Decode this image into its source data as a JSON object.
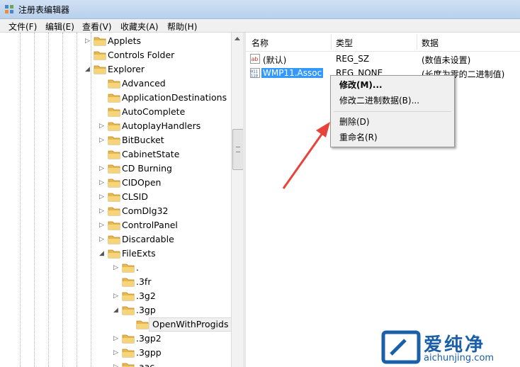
{
  "window": {
    "title": "注册表编辑器"
  },
  "menu": [
    "文件(F)",
    "编辑(E)",
    "查看(V)",
    "收藏夹(A)",
    "帮助(H)"
  ],
  "tree": [
    {
      "label": "Applets",
      "expander": "▷",
      "indent": 1
    },
    {
      "label": "Controls Folder",
      "expander": "",
      "indent": 1
    },
    {
      "label": "Explorer",
      "expander": "◢",
      "indent": 1
    },
    {
      "label": "Advanced",
      "expander": "",
      "indent": 2
    },
    {
      "label": "ApplicationDestinations",
      "expander": "",
      "indent": 2
    },
    {
      "label": "AutoComplete",
      "expander": "",
      "indent": 2
    },
    {
      "label": "AutoplayHandlers",
      "expander": "▷",
      "indent": 2
    },
    {
      "label": "BitBucket",
      "expander": "▷",
      "indent": 2
    },
    {
      "label": "CabinetState",
      "expander": "",
      "indent": 2
    },
    {
      "label": "CD Burning",
      "expander": "▷",
      "indent": 2
    },
    {
      "label": "CIDOpen",
      "expander": "▷",
      "indent": 2
    },
    {
      "label": "CLSID",
      "expander": "▷",
      "indent": 2
    },
    {
      "label": "ComDlg32",
      "expander": "▷",
      "indent": 2
    },
    {
      "label": "ControlPanel",
      "expander": "▷",
      "indent": 2
    },
    {
      "label": "Discardable",
      "expander": "▷",
      "indent": 2
    },
    {
      "label": "FileExts",
      "expander": "◢",
      "indent": 2
    },
    {
      "label": ".",
      "expander": "▷",
      "indent": 3
    },
    {
      "label": ".3fr",
      "expander": "",
      "indent": 3
    },
    {
      "label": ".3g2",
      "expander": "▷",
      "indent": 3
    },
    {
      "label": ".3gp",
      "expander": "◢",
      "indent": 3
    },
    {
      "label": "OpenWithProgids",
      "expander": "",
      "indent": 4,
      "selected": true
    },
    {
      "label": ".3gp2",
      "expander": "▷",
      "indent": 3
    },
    {
      "label": ".3gpp",
      "expander": "▷",
      "indent": 3
    },
    {
      "label": ".aac",
      "expander": "▷",
      "indent": 3
    }
  ],
  "list": {
    "headers": [
      "名称",
      "类型",
      "数据"
    ],
    "rows": [
      {
        "name": "(默认)",
        "type": "REG_SZ",
        "data": "(数值未设置)",
        "icon": "string-value-icon"
      },
      {
        "name": "WMP11.Assoc",
        "type": "REG_NONE",
        "data": "(长度为零的二进制值)",
        "icon": "binary-value-icon",
        "selected": true
      }
    ]
  },
  "context_menu": {
    "items": [
      {
        "label": "修改(M)...",
        "bold": true
      },
      {
        "label": "修改二进制数据(B)..."
      },
      {
        "label": "删除(D)"
      },
      {
        "label": "重命名(R)"
      }
    ]
  },
  "watermark": {
    "brand": "爱纯净",
    "url": "aichunjing.com"
  },
  "colors": {
    "selection": "#3399ff",
    "arrow": "#e8433a",
    "folder": "#e8b84a"
  }
}
